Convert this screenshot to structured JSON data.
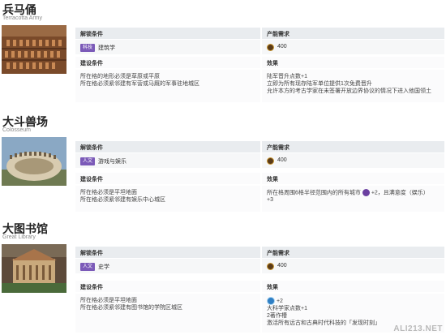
{
  "wonders": [
    {
      "name_cn": "兵马俑",
      "name_en": "Terracotta Army",
      "unlock_header": "解锁条件",
      "cost_header": "产能需求",
      "unlock_tag": "科技",
      "unlock_value": "建筑学",
      "cost_value": "400",
      "build_header": "建设条件",
      "effect_header": "效果",
      "build_lines": [
        "所在格的地形必须是草原或平原",
        "所在格必须紧邻建有军营或马厩的军事驻地城区"
      ],
      "effect_lines": [
        "陆军晋升点数+1",
        "立即为所有现存陆军单位提供1次免费晋升",
        "允许本方的考古学家在未签署开放边界协议的情况下进入他国领土"
      ]
    },
    {
      "name_cn": "大斗兽场",
      "name_en": "Colosseum",
      "unlock_header": "解锁条件",
      "cost_header": "产能需求",
      "unlock_tag": "人文",
      "unlock_value": "游戏与娱乐",
      "cost_value": "400",
      "build_header": "建设条件",
      "effect_header": "效果",
      "build_lines": [
        "所在格必须是平坦地面",
        "所在格必须紧邻建有娱乐中心城区"
      ],
      "effect_pre": "所在格周围6格半径范围内的所有城市",
      "effect_post": "+2，且满意度（娱乐）",
      "effect_line2": "+3"
    },
    {
      "name_cn": "大图书馆",
      "name_en": "Great Library",
      "unlock_header": "解锁条件",
      "cost_header": "产能需求",
      "unlock_tag": "人文",
      "unlock_value": "史学",
      "cost_value": "400",
      "build_header": "建设条件",
      "effect_header": "效果",
      "build_lines": [
        "所在格必须是平坦地面",
        "所在格必须紧邻建有图书馆的学院区城区"
      ],
      "effect_first": "+2",
      "effect_lines": [
        "大科学家点数+1",
        "2著作槽",
        "激活所有远古和古典时代科技的「发现时刻」"
      ]
    }
  ],
  "watermark": "ALI213.NET",
  "colors": {
    "tag": "#7b5ab8",
    "header_bg": "#e9ecef",
    "row_bg": "#f6f7f8"
  },
  "icons": {
    "cost": "production-coin-icon",
    "culture": "culture-icon",
    "science": "science-icon"
  }
}
